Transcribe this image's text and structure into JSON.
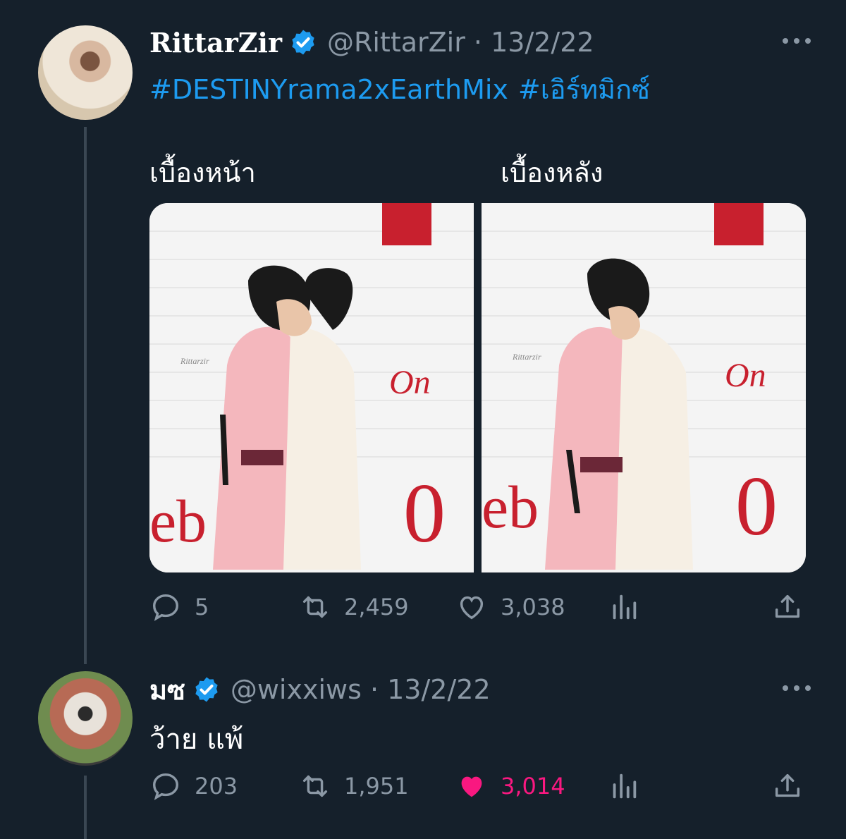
{
  "tweet1": {
    "name": "RittarZir",
    "handle": "@RittarZir · 13/2/22",
    "hashtags": [
      "#DESTINYrama2xEarthMix",
      "#เอิร์ทมิกซ์"
    ],
    "caption_left": "เบื้องหน้า",
    "caption_right": "เบื้องหลัง",
    "images": [
      {
        "text": "On",
        "big": "eb",
        "digit": "0",
        "watermark": "Rittarzir"
      },
      {
        "text": "On",
        "big": "eb",
        "digit": "0",
        "watermark": "Rittarzir"
      }
    ],
    "stats": {
      "replies": "5",
      "retweets": "2,459",
      "likes": "3,038"
    }
  },
  "tweet2": {
    "name": "มซ",
    "handle": "@wixxiws · 13/2/22",
    "text": "ว้าย แพ้",
    "stats": {
      "replies": "203",
      "retweets": "1,951",
      "likes": "3,014"
    }
  },
  "icons": {
    "verified": "verified-badge-icon",
    "reply": "reply-icon",
    "retweet": "retweet-icon",
    "like": "heart-icon",
    "analytics": "analytics-icon",
    "share": "share-icon",
    "more": "more-icon"
  },
  "colors": {
    "background": "#15202b",
    "link": "#1d9bf0",
    "muted": "#8b98a5",
    "liked": "#f91880"
  }
}
